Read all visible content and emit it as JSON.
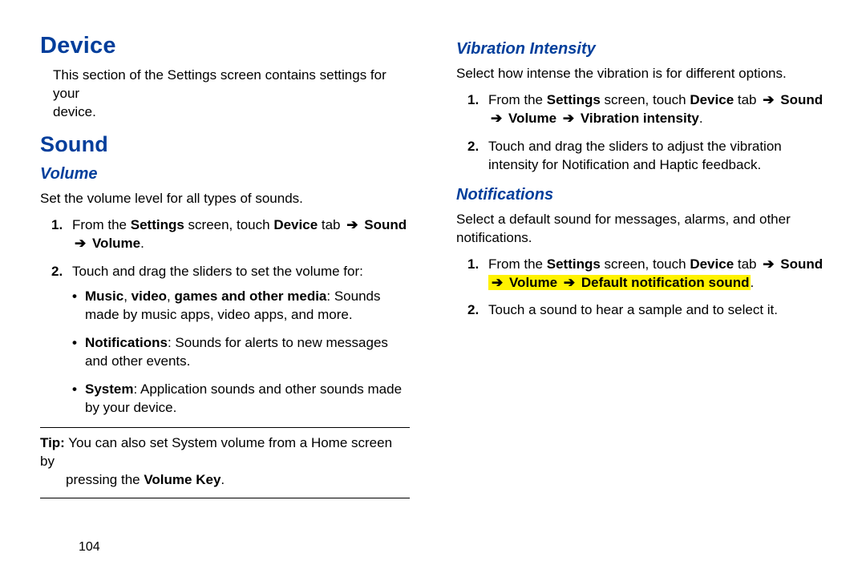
{
  "page_number": "104",
  "arrow_glyph": "➔",
  "left": {
    "h1": "Device",
    "intro_l1": "This section of the Settings screen contains settings for your ",
    "intro_l2": "device.",
    "h2": "Sound",
    "volume": {
      "heading": "Volume",
      "description": "Set the volume level for all types of sounds.",
      "step1_num": "1.",
      "step1_pre": "From the ",
      "step1_b1": "Settings",
      "step1_mid": " screen, touch ",
      "step1_b2": "Device",
      "step1_post": " tab ",
      "step1_b3": "Sound",
      "step1_line2_b": "Volume",
      "step1_line2_tail": ".",
      "step2_num": "2.",
      "step2_text": "Touch and drag the sliders to set the volume for:",
      "bullets": [
        {
          "b": "Music",
          "comma1": ", ",
          "b2": "video",
          "comma2": ", ",
          "b3": "games and other media",
          "colon": ": ",
          "rest": "Sounds made by music apps, video apps, and more."
        },
        {
          "b": "Notifications",
          "rest": ": Sounds for alerts to new messages and other events."
        },
        {
          "b": "System",
          "rest": ": Application sounds and other sounds made by your device."
        }
      ],
      "tip_label": "Tip:",
      "tip_l1": " You can also set System volume from a Home screen by ",
      "tip_l2_pre": "pressing the ",
      "tip_l2_b": "Volume Key",
      "tip_l2_tail": "."
    }
  },
  "right": {
    "vibration": {
      "heading": "Vibration Intensity",
      "description": "Select how intense the vibration is for different options.",
      "step1_num": "1.",
      "step1_pre": "From the ",
      "step1_b1": "Settings",
      "step1_mid": " screen, touch ",
      "step1_b2": "Device",
      "step1_post": " tab ",
      "step1_b3": "Sound",
      "step1_line2_b1": "Volume",
      "step1_line2_b2": "Vibration intensity",
      "step1_line2_tail": ".",
      "step2_num": "2.",
      "step2_text": "Touch and drag the sliders to adjust the vibration intensity for Notification and Haptic feedback."
    },
    "notifications": {
      "heading": "Notifications",
      "description": "Select a default sound for messages, alarms, and other notifications.",
      "step1_num": "1.",
      "step1_pre": "From the ",
      "step1_b1": "Settings",
      "step1_mid": " screen, touch ",
      "step1_b2": "Device",
      "step1_post": " tab ",
      "step1_b3": "Sound",
      "step1_hl_b1": "Volume",
      "step1_hl_b2": "Default notification sound",
      "step1_tail": ".",
      "step2_num": "2.",
      "step2_text": "Touch a sound to hear a sample and to select it."
    }
  }
}
